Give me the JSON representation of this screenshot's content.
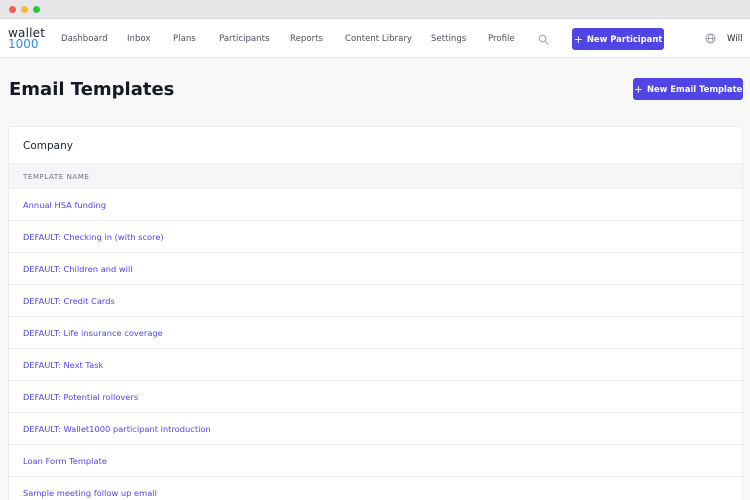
{
  "brand": {
    "line1": "wallet",
    "line2": "1000"
  },
  "nav": {
    "items": [
      "Dashboard",
      "Inbox",
      "Plans",
      "Participants",
      "Reports",
      "Content Library",
      "Settings",
      "Profile"
    ],
    "new_participant_label": "New Participant",
    "user_name": "Will",
    "icons": {
      "search": "search-icon",
      "language": "globe-icon"
    }
  },
  "page": {
    "title": "Email Templates",
    "new_template_label": "New Email Template"
  },
  "section": {
    "title": "Company",
    "column_header": "TEMPLATE NAME",
    "templates": [
      "Annual HSA funding",
      "DEFAULT: Checking in (with score)",
      "DEFAULT: Children and will",
      "DEFAULT: Credit Cards",
      "DEFAULT: Life insurance coverage",
      "DEFAULT: Next Task",
      "DEFAULT: Potential rollovers",
      "DEFAULT: Wallet1000 participant introduction",
      "Loan Form Template",
      "Sample meeting follow up email"
    ]
  },
  "colors": {
    "accent": "#4f46e5",
    "logo_blue": "#2f8fe0"
  }
}
